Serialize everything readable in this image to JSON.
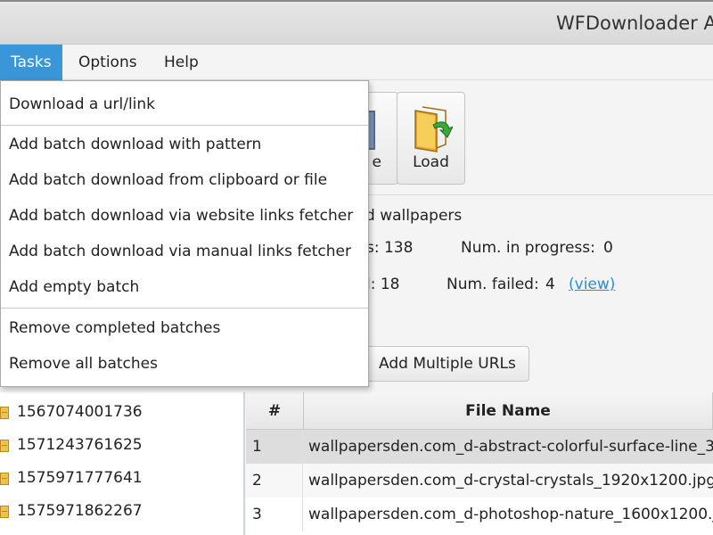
{
  "window": {
    "title": "WFDownloader A"
  },
  "menubar": {
    "tasks": "Tasks",
    "options": "Options",
    "help": "Help"
  },
  "tasks_menu": {
    "items": [
      "Download a url/link",
      "Add batch download with pattern",
      "Add batch download from clipboard or file",
      "Add batch download via website links fetcher",
      "Add batch download via manual links fetcher",
      "Add empty batch",
      "Remove completed batches",
      "Remove all batches"
    ]
  },
  "toolbar": {
    "hidden_label": "e",
    "load_label": "Load",
    "load_icon": "folder-green-arrow-icon"
  },
  "info": {
    "name_partial": "d wallpapers",
    "total_partial": "s: 138",
    "in_progress_label": "Num. in progress:",
    "in_progress_value": "0",
    "completed_partial": "l: 18",
    "failed_label": "Num. failed:",
    "failed_value": "4",
    "view_link": "(view)",
    "add_multiple": "Add Multiple URLs"
  },
  "batches": [
    "1567074001736",
    "1571243761625",
    "1575971777641",
    "1575971862267"
  ],
  "table": {
    "col_num": "#",
    "col_file": "File Name",
    "rows": [
      {
        "num": "1",
        "file": "wallpapersden.com_d-abstract-colorful-surface-line_3"
      },
      {
        "num": "2",
        "file": "wallpapersden.com_d-crystal-crystals_1920x1200.jpg"
      },
      {
        "num": "3",
        "file": "wallpapersden.com_d-photoshop-nature_1600x1200.jp"
      }
    ]
  },
  "colors": {
    "menu_active": "#3a96d6",
    "link": "#2a8fd4"
  }
}
